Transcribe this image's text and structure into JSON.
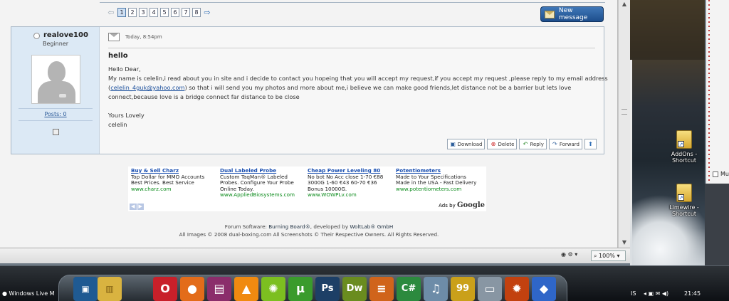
{
  "pagination": {
    "prev_arrow": "⇦",
    "pages": [
      "1",
      "2",
      "3",
      "4",
      "5",
      "6",
      "7",
      "8"
    ],
    "next_arrow": "⇨"
  },
  "toolbar": {
    "new_message_label": "New message"
  },
  "sender": {
    "username": "realove100",
    "rank": "Beginner",
    "posts_label": "Posts: 0"
  },
  "message": {
    "date": "Today, 8:54pm",
    "subject": "hello",
    "greeting": "Hello Dear,",
    "line1": "My name is celelin,i read about you in site and i decide to contact you hopeing that you will accept my request,if you accept my request ,please reply to my email address",
    "line2_open": "(",
    "email": "celelin_4guk@yahoo.com",
    "line2_rest": ") so that i will send you my photos and more about me,i believe we can make good friends,let distance not be a barrier but lets love",
    "line3": "connect,because love is a bridge connect far distance to be close",
    "closing": "Yours Lovely",
    "signature": "celelin"
  },
  "actions": {
    "download": "Download",
    "delete": "Delete",
    "reply": "Reply",
    "forward": "Forward"
  },
  "ads": [
    {
      "title": "Buy & Sell Charz",
      "l1": "Top Dollar for MMO Accounts",
      "l2": "Best Prices. Best Service",
      "l3": "",
      "url": "www.charz.com"
    },
    {
      "title": "Dual Labeled Probe",
      "l1": "Custom TaqMan® Labeled",
      "l2": "Probes. Configure Your Probe",
      "l3": "Online Today.",
      "url": "www.AppliedBiosystems.com"
    },
    {
      "title": "Cheap Power Leveling 80",
      "l1": "No bot No Acc close 1-70 €88",
      "l2": "3000G 1-60 €43 60-70 €36",
      "l3": "Bonus 10000G.",
      "url": "www.WOWPLv.com"
    },
    {
      "title": "Potentiometers",
      "l1": "Made to Your Specifications",
      "l2": "Made in the USA - Fast Delivery",
      "l3": "",
      "url": "www.potentiometers.com"
    }
  ],
  "ads_by": {
    "prefix": "Ads by",
    "brand": "Google"
  },
  "footer": {
    "software_prefix": "Forum Software: ",
    "software_name": "Burning Board®",
    "developed_by": ", developed by ",
    "developer": "WoltLab® GmbH",
    "copyright": "All Images © 2008 dual-boxing.com All Screenshots © Their Respective Owners. All Rights Reserved."
  },
  "statusbar": {
    "zoom": "100%"
  },
  "desktop": {
    "icons": [
      {
        "label1": "AddOns -",
        "label2": "Shortcut"
      },
      {
        "label1": "Limewire -",
        "label2": "Shortcut"
      }
    ],
    "partial_window_text": "Mu"
  },
  "taskbar": {
    "start_label": "Windows Live M",
    "language": "IS",
    "clock": "21:45",
    "apps": [
      {
        "name": "opera",
        "glyph": "O",
        "color": "#c8202a"
      },
      {
        "name": "firefox",
        "glyph": "●",
        "color": "#e36c1a"
      },
      {
        "name": "winrar",
        "glyph": "▤",
        "color": "#8b2d6b"
      },
      {
        "name": "vlc",
        "glyph": "▲",
        "color": "#f08a10"
      },
      {
        "name": "ventrilo",
        "glyph": "✺",
        "color": "#7cbf20"
      },
      {
        "name": "utorrent",
        "glyph": "µ",
        "color": "#3a9b2c"
      },
      {
        "name": "photoshop",
        "glyph": "Ps",
        "color": "#1d3f66"
      },
      {
        "name": "dreamweaver",
        "glyph": "Dw",
        "color": "#6a8c1f"
      },
      {
        "name": "bars",
        "glyph": "≡",
        "color": "#d0641b"
      },
      {
        "name": "csharp",
        "glyph": "C#",
        "color": "#2c8a3e"
      },
      {
        "name": "itunes",
        "glyph": "♫",
        "color": "#6d8ca8"
      },
      {
        "name": "99",
        "glyph": "99",
        "color": "#caa01a"
      },
      {
        "name": "computer",
        "glyph": "▭",
        "color": "#8896a3"
      },
      {
        "name": "fire",
        "glyph": "✹",
        "color": "#c2410f"
      },
      {
        "name": "cube",
        "glyph": "◆",
        "color": "#2f66c8"
      }
    ]
  }
}
